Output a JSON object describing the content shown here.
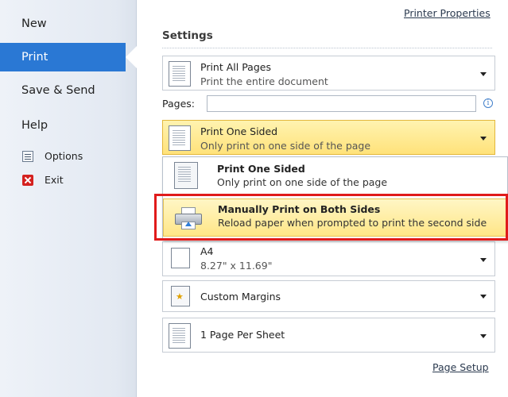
{
  "nav": {
    "items": [
      "New",
      "Print",
      "Save & Send",
      "Help"
    ],
    "selected": "Print",
    "sub_items": [
      {
        "label": "Options",
        "icon": "options-icon"
      },
      {
        "label": "Exit",
        "icon": "exit-icon"
      }
    ]
  },
  "links": {
    "printer_properties": "Printer Properties",
    "page_setup": "Page Setup"
  },
  "settings": {
    "title": "Settings",
    "print_range": {
      "title": "Print All Pages",
      "subtitle": "Print the entire document"
    },
    "pages_label": "Pages:",
    "pages_value": "",
    "sides": {
      "title": "Print One Sided",
      "subtitle": "Only print on one side of the page"
    },
    "paper": {
      "title": "A4",
      "subtitle": "8.27\" x 11.69\""
    },
    "margins": {
      "title": "Custom Margins"
    },
    "per_sheet": {
      "title": "1 Page Per Sheet"
    }
  },
  "popup": {
    "items": [
      {
        "title": "Print One Sided",
        "subtitle": "Only print on one side of the page"
      },
      {
        "title": "Manually Print on Both Sides",
        "subtitle": "Reload paper when prompted to print the second side"
      }
    ]
  },
  "colors": {
    "accent": "#2a78d4",
    "highlight": "#ffe27a",
    "annotation": "#e01b1b"
  }
}
